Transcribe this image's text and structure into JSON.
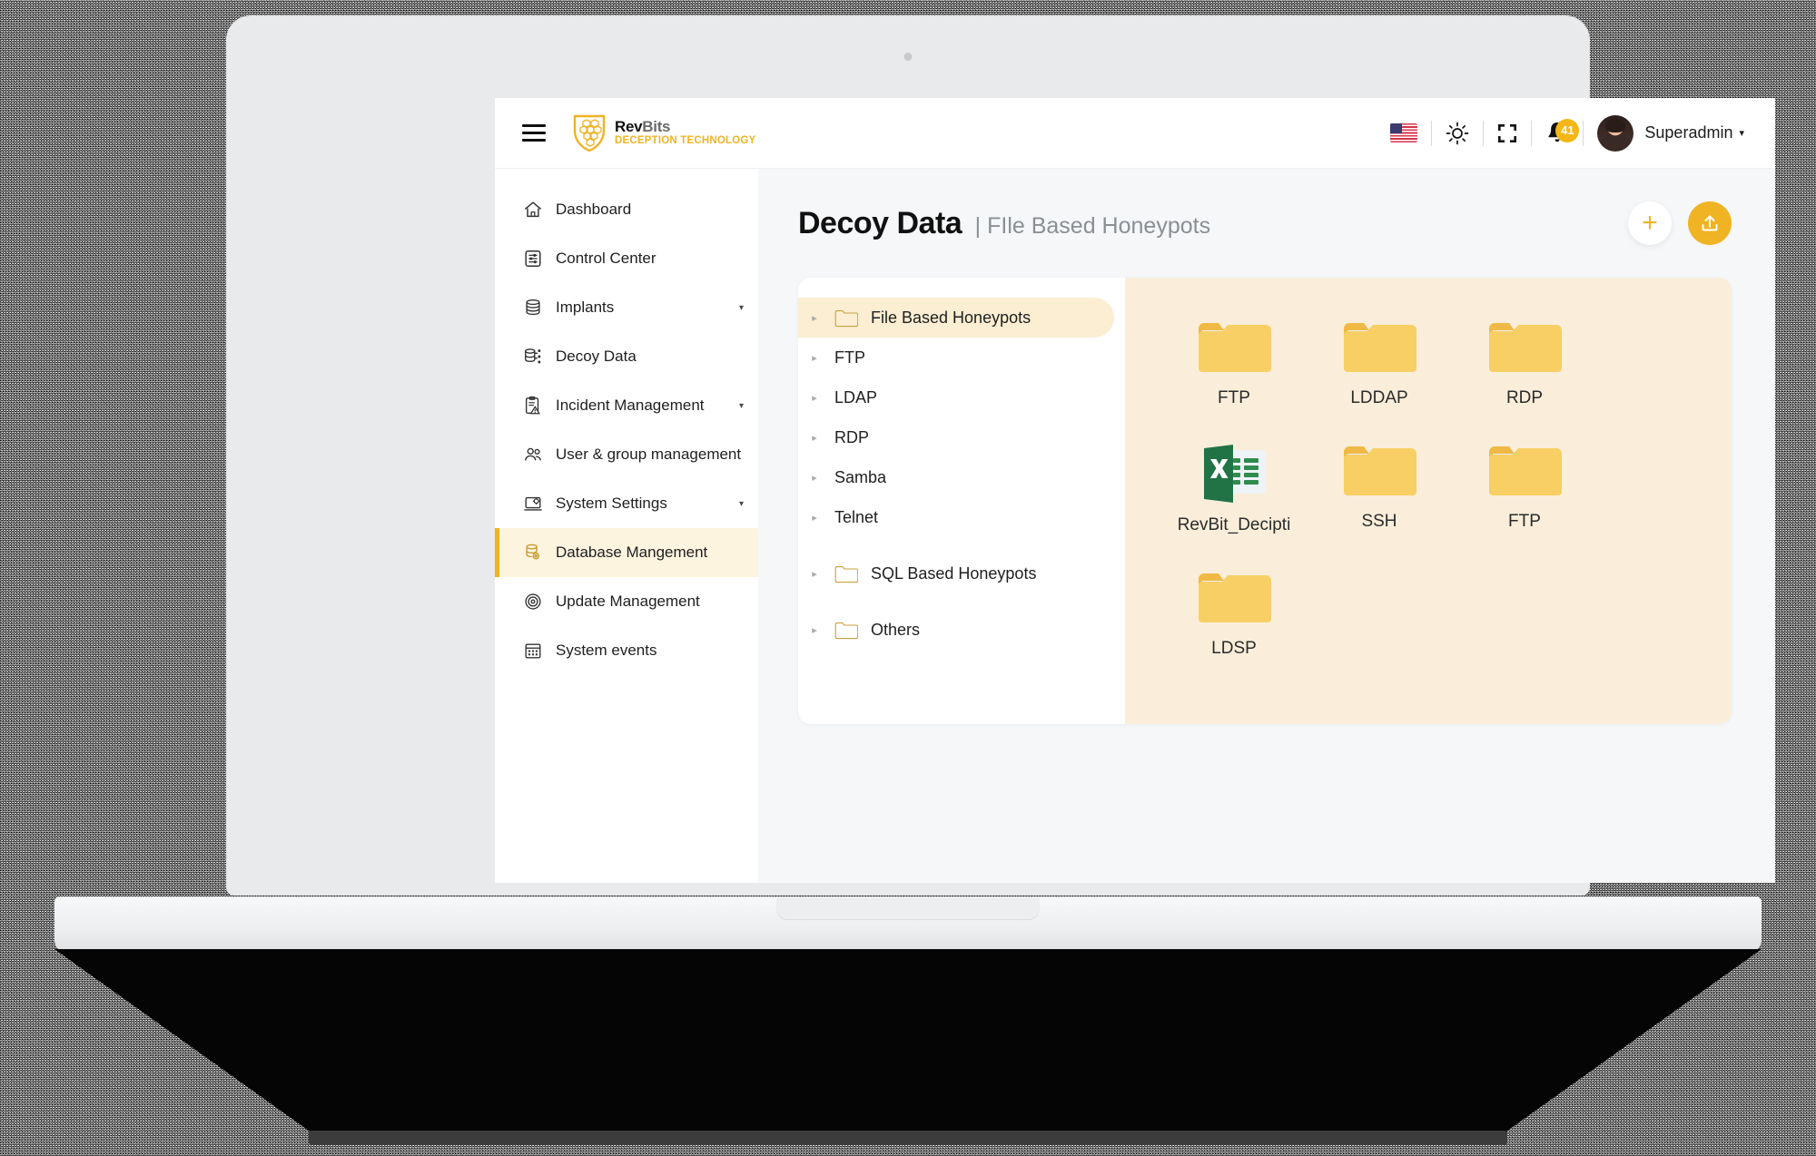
{
  "header": {
    "logo": {
      "name": "RevBits",
      "name_bold": "Rev",
      "name_light": "Bits",
      "tagline": "DECEPTION TECHNOLOGY"
    },
    "menu_icon": "hamburger-menu-icon",
    "language_flag": "us-flag-icon",
    "theme_icon": "sun-icon",
    "fullscreen_icon": "fullscreen-icon",
    "notifications_icon": "bell-icon",
    "notifications_count": "41",
    "avatar": "user-avatar",
    "user_name": "Superadmin",
    "user_caret": "▾"
  },
  "sidebar": {
    "items": [
      {
        "label": "Dashboard",
        "icon": "home-icon",
        "has_caret": false,
        "active": false
      },
      {
        "label": "Control Center",
        "icon": "sliders-icon",
        "has_caret": false,
        "active": false
      },
      {
        "label": "Implants",
        "icon": "database-stack-icon",
        "has_caret": true,
        "active": false
      },
      {
        "label": "Decoy Data",
        "icon": "decoy-database-icon",
        "has_caret": false,
        "active": false
      },
      {
        "label": "Incident Management",
        "icon": "clipboard-alert-icon",
        "has_caret": true,
        "active": false
      },
      {
        "label": "User & group management",
        "icon": "users-group-icon",
        "has_caret": false,
        "active": false
      },
      {
        "label": "System Settings",
        "icon": "laptop-settings-icon",
        "has_caret": true,
        "active": false
      },
      {
        "label": "Database Mangement",
        "icon": "database-gear-icon",
        "has_caret": false,
        "active": true
      },
      {
        "label": "Update Management",
        "icon": "refresh-circle-icon",
        "has_caret": false,
        "active": false
      },
      {
        "label": "System events",
        "icon": "calendar-icon",
        "has_caret": false,
        "active": false
      }
    ],
    "caret_glyph": "▾"
  },
  "page": {
    "title": "Decoy Data",
    "subtitle": "| FIle Based Honeypots",
    "add_button_icon": "plus-icon",
    "add_button_glyph": "+",
    "upload_button_icon": "upload-icon"
  },
  "tree": {
    "expander_glyph": "▸",
    "nodes": [
      {
        "label": "File Based Honeypots",
        "has_folder": true,
        "selected": true,
        "indent": 0
      },
      {
        "label": "FTP",
        "has_folder": false,
        "selected": false,
        "indent": 1
      },
      {
        "label": "LDAP",
        "has_folder": false,
        "selected": false,
        "indent": 1
      },
      {
        "label": "RDP",
        "has_folder": false,
        "selected": false,
        "indent": 1
      },
      {
        "label": "Samba",
        "has_folder": false,
        "selected": false,
        "indent": 1
      },
      {
        "label": "Telnet",
        "has_folder": false,
        "selected": false,
        "indent": 1
      },
      {
        "label": "SQL Based Honeypots",
        "has_folder": true,
        "selected": false,
        "indent": 0
      },
      {
        "label": "Others",
        "has_folder": true,
        "selected": false,
        "indent": 0
      }
    ]
  },
  "files": {
    "items": [
      {
        "label": "FTP",
        "type": "folder"
      },
      {
        "label": "LDDAP",
        "type": "folder"
      },
      {
        "label": "RDP",
        "type": "folder"
      },
      {
        "label": "RevBit_Decipti",
        "type": "excel"
      },
      {
        "label": "SSH",
        "type": "folder"
      },
      {
        "label": "FTP",
        "type": "folder"
      },
      {
        "label": "LDSP",
        "type": "folder"
      }
    ]
  },
  "colors": {
    "brand_yellow": "#f0b323",
    "folder_yellow": "#f8cf64",
    "panel_cream": "#faeeda",
    "selection_cream": "#fbeed3",
    "excel_green": "#217346",
    "content_bg": "#f5f7f9"
  }
}
